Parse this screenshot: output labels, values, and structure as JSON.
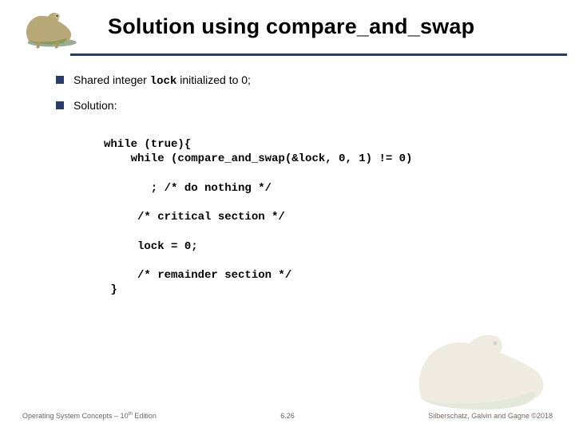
{
  "header": {
    "title": "Solution using compare_and_swap"
  },
  "bullets": {
    "b1_pre": "Shared integer ",
    "b1_code": "lock",
    "b1_post": " initialized to 0;",
    "b2": "Solution:"
  },
  "code": {
    "l1": "while (true){",
    "l2": "    while (compare_and_swap(&lock, 0, 1) != 0)",
    "l3": "       ; /* do nothing */",
    "l4": "     /* critical section */",
    "l5": "     lock = 0;",
    "l6": "     /* remainder section */",
    "l7": " }"
  },
  "footer": {
    "left_pre": "Operating System Concepts – 10",
    "left_sup": "th",
    "left_post": " Edition",
    "center": "6.26",
    "right": "Silberschatz, Galvin and Gagne ©2018"
  }
}
